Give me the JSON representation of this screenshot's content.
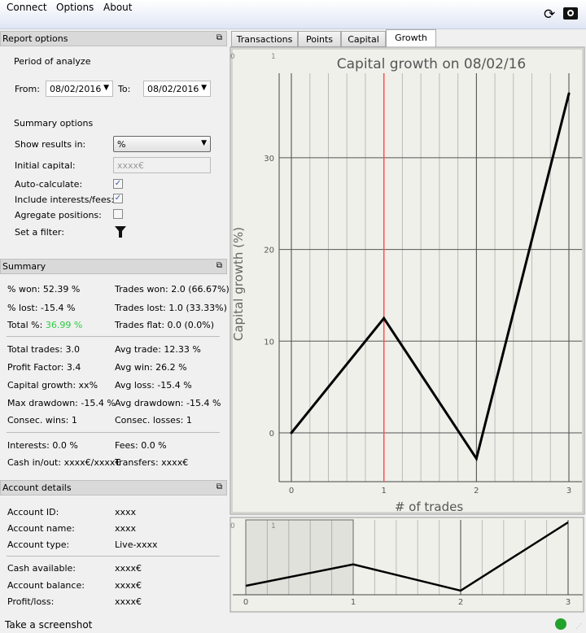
{
  "menu": {
    "connect": "Connect",
    "options": "Options",
    "about": "About"
  },
  "report": {
    "title": "Report options",
    "period": "Period of analyze",
    "from_label": "From:",
    "from": "08/02/2016",
    "to_label": "To:",
    "to": "08/02/2016",
    "summary_options": "Summary options",
    "show_results_label": "Show results in:",
    "show_results": "%",
    "initial_capital_label": "Initial capital:",
    "initial_capital_placeholder": "xxxx€",
    "auto_calc_label": "Auto-calculate:",
    "auto_calc": true,
    "include_label": "Include interests/fees:",
    "include": true,
    "aggregate_label": "Agregate positions:",
    "aggregate": false,
    "filter_label": "Set a filter:"
  },
  "summary": {
    "title": "Summary",
    "won_pct": "% won: 52.39 %",
    "lost_pct": "% lost: -15.4 %",
    "total_label": "Total %:",
    "total_value": "36.99 %",
    "trades_won": "Trades won: 2.0 (66.67%)",
    "trades_lost": "Trades lost: 1.0 (33.33%)",
    "trades_flat": "Trades flat: 0.0 (0.0%)",
    "total_trades": "Total trades: 3.0",
    "avg_trade": "Avg trade: 12.33 %",
    "profit_factor": "Profit Factor: 3.4",
    "avg_win": "Avg win: 26.2 %",
    "capital_growth": "Capital growth: xx%",
    "avg_loss": "Avg loss: -15.4 %",
    "max_dd": "Max drawdown: -15.4 %",
    "avg_dd": "Avg drawdown: -15.4 %",
    "consec_wins": "Consec. wins: 1",
    "consec_losses": "Consec. losses: 1",
    "interests": "Interests: 0.0 %",
    "fees": "Fees: 0.0 %",
    "cash": "Cash in/out: xxxx€/xxxx€",
    "transfers": "Transfers: xxxx€",
    "total_color": "#2ecc40"
  },
  "account": {
    "title": "Account details",
    "rows": [
      [
        "Account ID:",
        "xxxx"
      ],
      [
        "Account name:",
        "xxxx"
      ],
      [
        "Account type:",
        "Live-xxxx"
      ],
      [
        "Cash available:",
        "xxxx€"
      ],
      [
        "Account balance:",
        "xxxx€"
      ],
      [
        "Profit/loss:",
        "xxxx€"
      ]
    ]
  },
  "tabs": [
    "Transactions",
    "Points",
    "Capital",
    "Growth"
  ],
  "active_tab": "Growth",
  "status": {
    "text": "Take a screenshot",
    "indicator_color": "#22a22a"
  },
  "chart_data": {
    "type": "line",
    "title": "Capital growth on 08/02/16",
    "xlabel": "# of trades",
    "ylabel": "Capital growth (%)",
    "x": [
      0,
      1,
      2,
      3
    ],
    "values": [
      0,
      12.5,
      -2.8,
      37.0
    ],
    "xlim": [
      -0.13,
      3.1
    ],
    "ylim": [
      -5.3,
      39.2
    ],
    "xticks": [
      0,
      1,
      2,
      3
    ],
    "yticks": [
      0,
      10,
      20,
      30
    ],
    "cursor_x": 1,
    "cursor_color": "#ff5050",
    "corner_labels": [
      "0",
      "1"
    ],
    "grid": true,
    "overview": {
      "xticks": [
        0,
        1,
        2,
        3
      ],
      "selection": [
        0,
        1
      ],
      "corner_labels": [
        "0",
        "1"
      ]
    }
  }
}
